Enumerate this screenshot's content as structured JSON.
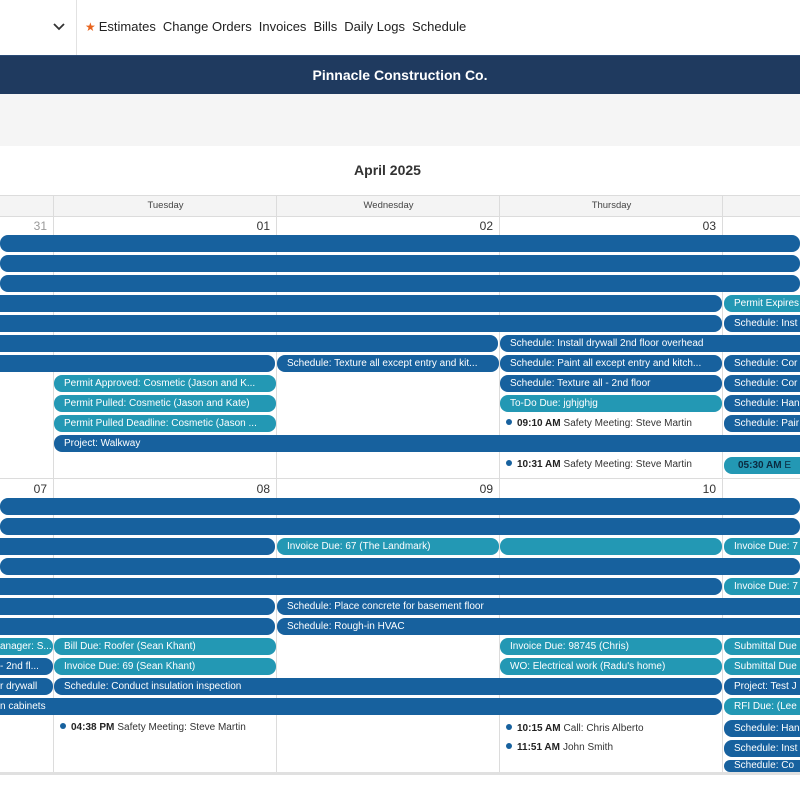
{
  "nav": {
    "items": [
      "Estimates",
      "Change Orders",
      "Invoices",
      "Bills",
      "Daily Logs",
      "Schedule"
    ]
  },
  "company": {
    "name": "Pinnacle Construction Co."
  },
  "calendar": {
    "month_label": "April 2025",
    "day_names": [
      "Tuesday",
      "Wednesday",
      "Thursday"
    ],
    "week1_dates": [
      "31",
      "01",
      "02",
      "03"
    ],
    "week2_dates": [
      "07",
      "08",
      "09",
      "10"
    ]
  },
  "events": [
    "Permit Expires",
    "Schedule: Inst",
    "Schedule: Install drywall 2nd floor overhead",
    "Schedule: Texture all except entry and kit...",
    "Schedule: Paint all except entry and kitch...",
    "Schedule: Cor",
    "Permit Approved: Cosmetic (Jason and K...",
    "Schedule: Texture all - 2nd floor",
    "Schedule: Cor",
    "Permit Pulled: Cosmetic (Jason and Kate)",
    "To-Do Due: jghjghjg",
    "Schedule: Han",
    "Permit Pulled Deadline: Cosmetic (Jason ...",
    "Schedule: Pair",
    "Project: Walkway",
    "Invoice Due: 67 (The Landmark)",
    "Invoice Due: 7",
    "Invoice Due: 7",
    "Schedule: Place concrete for basement floor",
    "Schedule: Rough-in HVAC",
    "anager: S...",
    "Bill Due: Roofer (Sean Khant)",
    "Invoice Due: 98745 (Chris)",
    "Submittal Due",
    "- 2nd fl...",
    "Invoice Due: 69 (Sean Khant)",
    "WO: Electrical work (Radu's home)",
    "Submittal Due",
    "r drywall",
    "Schedule: Conduct insulation inspection",
    "Project: Test J",
    "n cabinets",
    "RFI Due: (Lee",
    "Schedule: Han",
    "Schedule: Inst",
    "Schedule: Co"
  ],
  "timed_events": [
    {
      "time": "09:10 AM",
      "title": "Safety Meeting: Steve Martin"
    },
    {
      "time": "10:31 AM",
      "title": "Safety Meeting: Steve Martin"
    },
    {
      "time": "05:30 AM",
      "title": "E"
    },
    {
      "time": "04:38 PM",
      "title": "Safety Meeting: Steve Martin"
    },
    {
      "time": "10:15 AM",
      "title": "Call: Chris Alberto"
    },
    {
      "time": "11:51 AM",
      "title": "John Smith"
    }
  ],
  "colors": {
    "navy": "#1f3a5f",
    "event_dark": "#17619e",
    "event_teal": "#2398b4",
    "star": "#e8641e"
  }
}
